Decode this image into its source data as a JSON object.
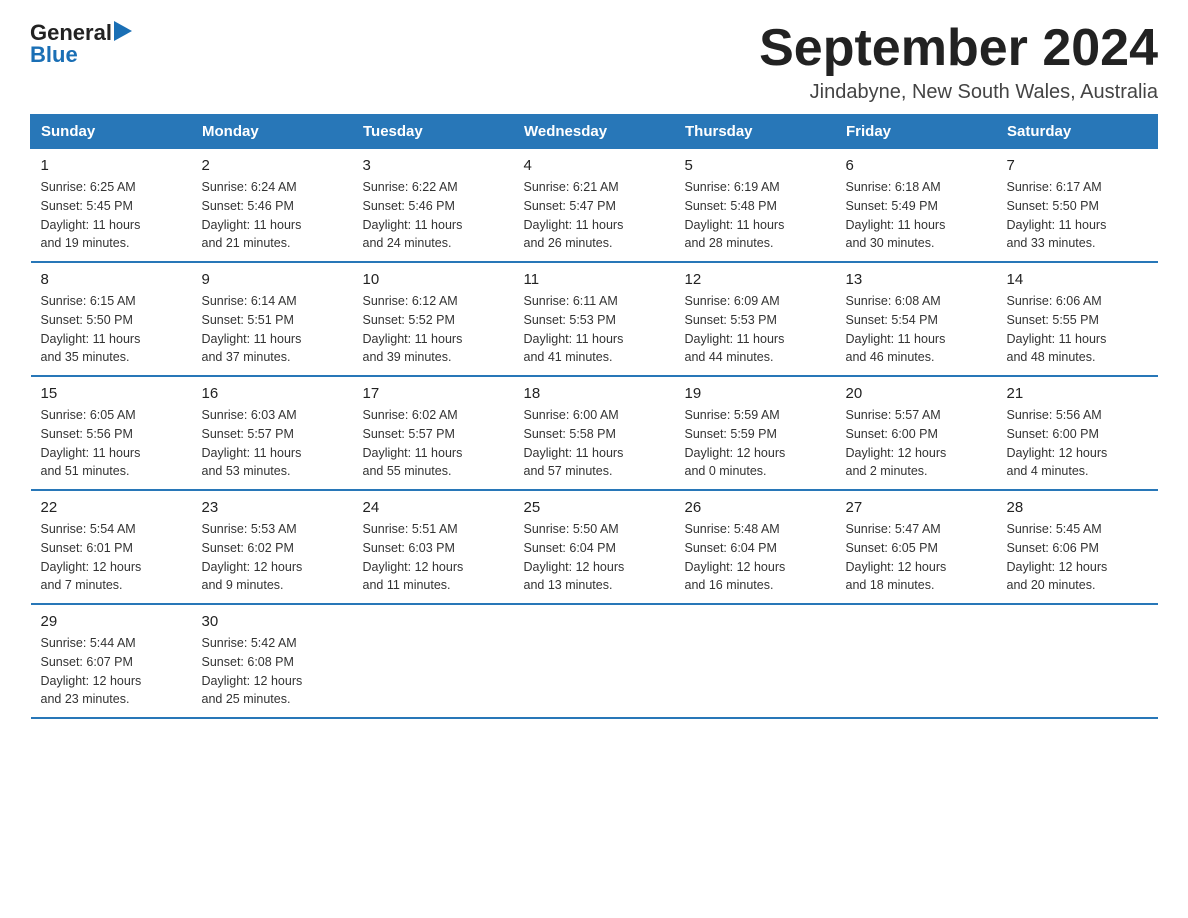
{
  "header": {
    "logo_general": "General",
    "logo_blue": "Blue",
    "title": "September 2024",
    "subtitle": "Jindabyne, New South Wales, Australia"
  },
  "days_of_week": [
    "Sunday",
    "Monday",
    "Tuesday",
    "Wednesday",
    "Thursday",
    "Friday",
    "Saturday"
  ],
  "weeks": [
    [
      {
        "day": "1",
        "sunrise": "6:25 AM",
        "sunset": "5:45 PM",
        "daylight": "11 hours and 19 minutes."
      },
      {
        "day": "2",
        "sunrise": "6:24 AM",
        "sunset": "5:46 PM",
        "daylight": "11 hours and 21 minutes."
      },
      {
        "day": "3",
        "sunrise": "6:22 AM",
        "sunset": "5:46 PM",
        "daylight": "11 hours and 24 minutes."
      },
      {
        "day": "4",
        "sunrise": "6:21 AM",
        "sunset": "5:47 PM",
        "daylight": "11 hours and 26 minutes."
      },
      {
        "day": "5",
        "sunrise": "6:19 AM",
        "sunset": "5:48 PM",
        "daylight": "11 hours and 28 minutes."
      },
      {
        "day": "6",
        "sunrise": "6:18 AM",
        "sunset": "5:49 PM",
        "daylight": "11 hours and 30 minutes."
      },
      {
        "day": "7",
        "sunrise": "6:17 AM",
        "sunset": "5:50 PM",
        "daylight": "11 hours and 33 minutes."
      }
    ],
    [
      {
        "day": "8",
        "sunrise": "6:15 AM",
        "sunset": "5:50 PM",
        "daylight": "11 hours and 35 minutes."
      },
      {
        "day": "9",
        "sunrise": "6:14 AM",
        "sunset": "5:51 PM",
        "daylight": "11 hours and 37 minutes."
      },
      {
        "day": "10",
        "sunrise": "6:12 AM",
        "sunset": "5:52 PM",
        "daylight": "11 hours and 39 minutes."
      },
      {
        "day": "11",
        "sunrise": "6:11 AM",
        "sunset": "5:53 PM",
        "daylight": "11 hours and 41 minutes."
      },
      {
        "day": "12",
        "sunrise": "6:09 AM",
        "sunset": "5:53 PM",
        "daylight": "11 hours and 44 minutes."
      },
      {
        "day": "13",
        "sunrise": "6:08 AM",
        "sunset": "5:54 PM",
        "daylight": "11 hours and 46 minutes."
      },
      {
        "day": "14",
        "sunrise": "6:06 AM",
        "sunset": "5:55 PM",
        "daylight": "11 hours and 48 minutes."
      }
    ],
    [
      {
        "day": "15",
        "sunrise": "6:05 AM",
        "sunset": "5:56 PM",
        "daylight": "11 hours and 51 minutes."
      },
      {
        "day": "16",
        "sunrise": "6:03 AM",
        "sunset": "5:57 PM",
        "daylight": "11 hours and 53 minutes."
      },
      {
        "day": "17",
        "sunrise": "6:02 AM",
        "sunset": "5:57 PM",
        "daylight": "11 hours and 55 minutes."
      },
      {
        "day": "18",
        "sunrise": "6:00 AM",
        "sunset": "5:58 PM",
        "daylight": "11 hours and 57 minutes."
      },
      {
        "day": "19",
        "sunrise": "5:59 AM",
        "sunset": "5:59 PM",
        "daylight": "12 hours and 0 minutes."
      },
      {
        "day": "20",
        "sunrise": "5:57 AM",
        "sunset": "6:00 PM",
        "daylight": "12 hours and 2 minutes."
      },
      {
        "day": "21",
        "sunrise": "5:56 AM",
        "sunset": "6:00 PM",
        "daylight": "12 hours and 4 minutes."
      }
    ],
    [
      {
        "day": "22",
        "sunrise": "5:54 AM",
        "sunset": "6:01 PM",
        "daylight": "12 hours and 7 minutes."
      },
      {
        "day": "23",
        "sunrise": "5:53 AM",
        "sunset": "6:02 PM",
        "daylight": "12 hours and 9 minutes."
      },
      {
        "day": "24",
        "sunrise": "5:51 AM",
        "sunset": "6:03 PM",
        "daylight": "12 hours and 11 minutes."
      },
      {
        "day": "25",
        "sunrise": "5:50 AM",
        "sunset": "6:04 PM",
        "daylight": "12 hours and 13 minutes."
      },
      {
        "day": "26",
        "sunrise": "5:48 AM",
        "sunset": "6:04 PM",
        "daylight": "12 hours and 16 minutes."
      },
      {
        "day": "27",
        "sunrise": "5:47 AM",
        "sunset": "6:05 PM",
        "daylight": "12 hours and 18 minutes."
      },
      {
        "day": "28",
        "sunrise": "5:45 AM",
        "sunset": "6:06 PM",
        "daylight": "12 hours and 20 minutes."
      }
    ],
    [
      {
        "day": "29",
        "sunrise": "5:44 AM",
        "sunset": "6:07 PM",
        "daylight": "12 hours and 23 minutes."
      },
      {
        "day": "30",
        "sunrise": "5:42 AM",
        "sunset": "6:08 PM",
        "daylight": "12 hours and 25 minutes."
      },
      null,
      null,
      null,
      null,
      null
    ]
  ],
  "labels": {
    "sunrise": "Sunrise:",
    "sunset": "Sunset:",
    "daylight": "Daylight:"
  }
}
